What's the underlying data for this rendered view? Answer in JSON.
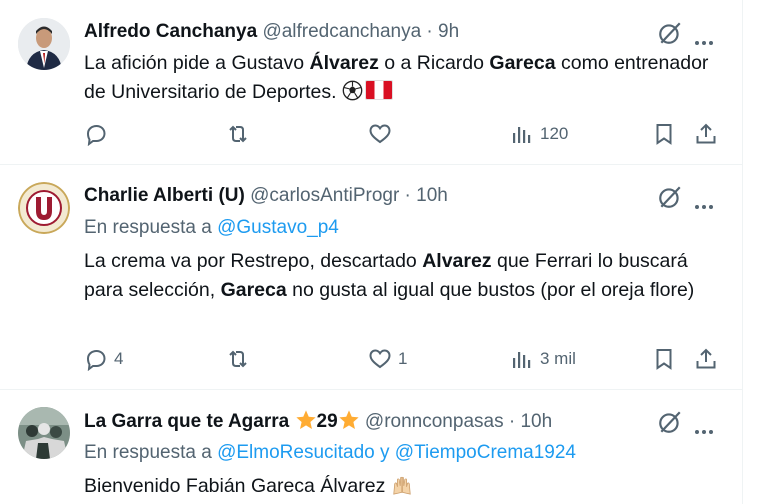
{
  "tweets": [
    {
      "author_name": "Alfredo Canchanya",
      "handle": "@alfredcanchanya",
      "time": "9h",
      "text_parts": [
        "La afición pide a Gustavo ",
        "Álvarez",
        " o a Ricardo ",
        "Gareca",
        " como entrenador de Universitario de Deportes. "
      ],
      "emojis": [
        "soccer-ball",
        "peru-flag"
      ],
      "replies": "",
      "reposts": "",
      "likes": "",
      "views": "120"
    },
    {
      "author_name": "Charlie Alberti (U)",
      "handle": "@carlosAntiProgr",
      "time": "10h",
      "reply_prefix": "En respuesta a ",
      "reply_to": "@Gustavo_p4",
      "text_parts": [
        "La crema va por Restrepo, descartado ",
        "Alvarez",
        " que Ferrari lo buscará para selección, ",
        "Gareca",
        " no gusta al igual que bustos (por el oreja flore)"
      ],
      "replies": "4",
      "reposts": "",
      "likes": "1",
      "views": "3 mil"
    },
    {
      "author_name": "La Garra que te Agarra",
      "name_number": "29",
      "handle": "@ronnconpasas",
      "time": "10h",
      "reply_prefix": "En respuesta a ",
      "reply_to": "@ElmoResucitado y @TiempoCrema1924",
      "text": "Bienvenido Fabián Gareca Álvarez",
      "emojis": [
        "raising-hands"
      ]
    }
  ],
  "separator": " · ",
  "colors": {
    "text": "#0f1419",
    "muted": "#536471",
    "link": "#1d9bf0",
    "border": "#eff3f4",
    "star": "#ffac33"
  }
}
